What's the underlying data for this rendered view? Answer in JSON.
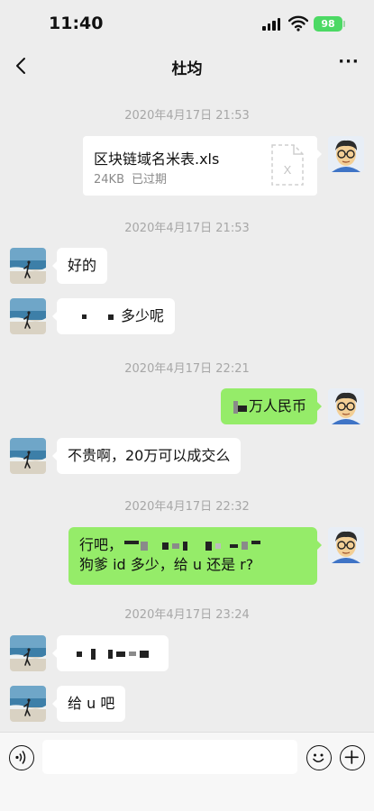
{
  "status_bar": {
    "time": "11:40",
    "battery": "98"
  },
  "header": {
    "title": "杜均",
    "back_icon": "chevron-left-icon",
    "more_label": "···"
  },
  "timestamps": [
    "2020年4月17日 21:53",
    "2020年4月17日 21:53",
    "2020年4月17日 22:21",
    "2020年4月17日 22:32",
    "2020年4月17日 23:24"
  ],
  "file_message": {
    "name": "区块链域名米表.xls",
    "size": "24KB",
    "status": "已过期",
    "icon_letter": "X"
  },
  "messages": [
    {
      "from": "them",
      "text": "好的"
    },
    {
      "from": "them",
      "text": "多少呢"
    },
    {
      "from": "me",
      "text": "万人民币"
    },
    {
      "from": "them",
      "text": "不贵啊，20万可以成交么"
    },
    {
      "from": "me",
      "text_line1": "行吧，",
      "text_line2": "狗爹 id 多少，给 u 还是 r?"
    },
    {
      "from": "them",
      "text": ""
    },
    {
      "from": "them",
      "text": "给 u 吧"
    }
  ],
  "colors": {
    "background": "#ededed",
    "outgoing_bubble": "#95ec69",
    "incoming_bubble": "#ffffff",
    "battery": "#4cd964"
  }
}
